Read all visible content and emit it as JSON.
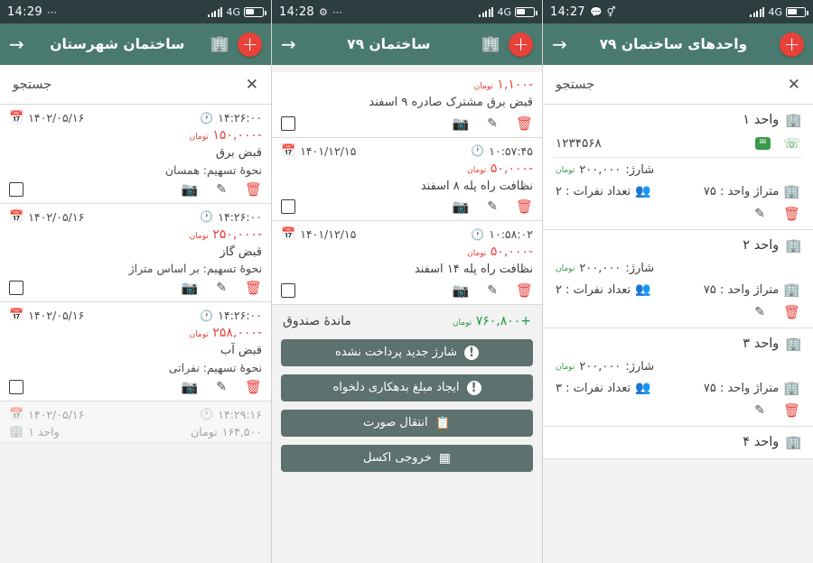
{
  "panels": [
    {
      "id": "units-list",
      "status": {
        "time": "14:27",
        "left_icons": [
          "chat-icon",
          "bluetooth-icon"
        ],
        "network": "4G",
        "battery_level": "60"
      },
      "appbar": {
        "title": "واحدهای ساختمان ۷۹",
        "back_icon": "arrow-back-icon",
        "add_icon": "add-icon"
      },
      "search": {
        "label": "جستجو",
        "close_icon": "close-icon"
      },
      "units": [
        {
          "title": "واحد ۱",
          "phone": "۱۲۳۴۵۶۸",
          "charge_label": "شارژ:",
          "charge_value": "۲۰۰,۰۰۰",
          "charge_unit": "تومان",
          "people_label": "تعداد نفرات : ۲",
          "area_label": "متراژ واحد : ۷۵",
          "has_contact": true
        },
        {
          "title": "واحد ۲",
          "charge_label": "شارژ:",
          "charge_value": "۲۰۰,۰۰۰",
          "charge_unit": "تومان",
          "people_label": "تعداد نفرات : ۲",
          "area_label": "متراژ واحد : ۷۵",
          "has_contact": false
        },
        {
          "title": "واحد ۳",
          "charge_label": "شارژ:",
          "charge_value": "۲۰۰,۰۰۰",
          "charge_unit": "تومان",
          "people_label": "تعداد نفرات : ۳",
          "area_label": "متراژ واحد : ۷۵",
          "has_contact": false
        },
        {
          "title": "واحد ۴",
          "charge_label": "",
          "charge_value": "",
          "charge_unit": "",
          "people_label": "",
          "area_label": "",
          "has_contact": false
        }
      ]
    },
    {
      "id": "building-79-transactions",
      "status": {
        "time": "14:28",
        "left_icons": [
          "sync-icon",
          "more-icon"
        ],
        "network": "4G",
        "battery_level": "55"
      },
      "appbar": {
        "title": "ساختمان ۷۹",
        "back_icon": "arrow-back-icon",
        "add_icon": "add-icon",
        "building_icon": "building-icon"
      },
      "transactions": [
        {
          "date": "",
          "time": "",
          "amount": "-۱,۱۰۰",
          "unit": "تومان",
          "desc": "قبض برق مشترک صادره ۹ اسفند",
          "sub": "",
          "partial": true
        },
        {
          "date": "۱۴۰۱/۱۲/۱۵",
          "time": "۱۰:۵۷:۴۵",
          "amount": "-۵۰,۰۰۰",
          "unit": "تومان",
          "desc": "نظافت راه پله ۸ اسفند",
          "sub": ""
        },
        {
          "date": "۱۴۰۱/۱۲/۱۵",
          "time": "۱۰:۵۸:۰۲",
          "amount": "-۵۰,۰۰۰",
          "unit": "تومان",
          "desc": "نظافت راه پله ۱۴ اسفند",
          "sub": ""
        }
      ],
      "balance": {
        "label": "ماندۀ صندوق",
        "value": "+۷۶۰,۸۰۰",
        "unit": "تومان"
      },
      "buttons": [
        {
          "label": "شارژ جدید پرداخت نشده",
          "icon": "warning-icon"
        },
        {
          "label": "ایجاد مبلغ بدهکاری دلخواه",
          "icon": "warning-icon"
        },
        {
          "label": "انتقال صورت",
          "icon": "copy-icon"
        },
        {
          "label": "خروجی اکسل",
          "icon": "table-icon"
        }
      ]
    },
    {
      "id": "city-building-transactions",
      "status": {
        "time": "14:29",
        "left_icons": [
          "more-icon"
        ],
        "network": "4G",
        "battery_level": "58"
      },
      "appbar": {
        "title": "ساختمان شهرستان",
        "back_icon": "arrow-back-icon",
        "add_icon": "add-icon",
        "building_icon": "building-icon"
      },
      "search": {
        "label": "جستجو",
        "close_icon": "close-icon"
      },
      "transactions": [
        {
          "date": "۱۴۰۲/۰۵/۱۶",
          "time": "۱۴:۲۶:۰۰",
          "amount": "-۱۵۰,۰۰۰",
          "unit": "تومان",
          "desc": "قبض برق",
          "sub": "نحوۀ تسهیم: همسان"
        },
        {
          "date": "۱۴۰۲/۰۵/۱۶",
          "time": "۱۴:۲۶:۰۰",
          "amount": "-۲۵۰,۰۰۰",
          "unit": "تومان",
          "desc": "قبض گاز",
          "sub": "نحوۀ تسهیم: بر اساس متراژ"
        },
        {
          "date": "۱۴۰۲/۰۵/۱۶",
          "time": "۱۴:۲۶:۰۰",
          "amount": "-۲۵۸,۰۰۰",
          "unit": "تومان",
          "desc": "قبض آب",
          "sub": "نحوۀ تسهیم: نفراتی"
        }
      ],
      "faded_row": {
        "date": "۱۴۰۲/۰۵/۱۶",
        "time": "۱۴:۲۹:۱۶",
        "amount": "۱۶۴,۵۰۰",
        "unit": "تومان",
        "unit_label": "واحد ۱"
      }
    }
  ],
  "colors": {
    "appbar": "#4a7a6f",
    "statusbar": "#2d3e40",
    "accent_red": "#e8413a",
    "accent_green": "#3a9a49",
    "button": "#5d716f",
    "positive": "#1f9a3f"
  },
  "icons": {
    "trash": "Ὕ1",
    "pencil": "✎",
    "camera": "▣",
    "calendar": "Ὄ5",
    "clock": "ὕ2",
    "phone": "☎",
    "people": "὆5"
  }
}
